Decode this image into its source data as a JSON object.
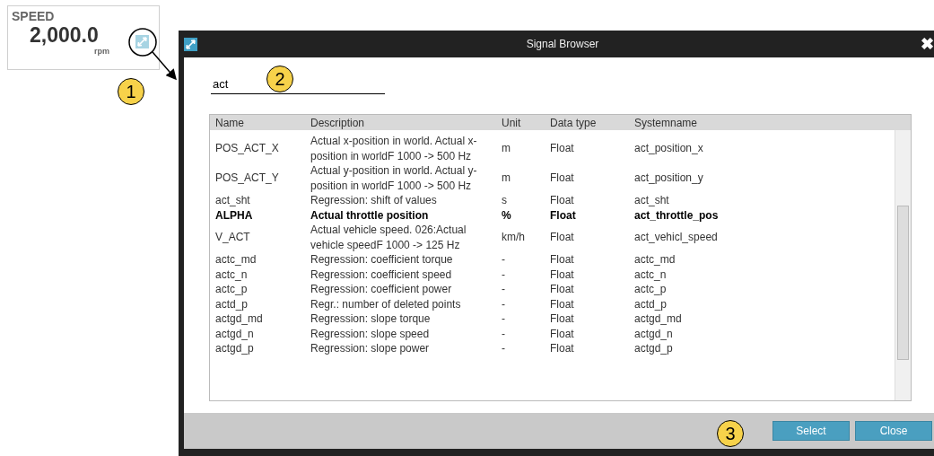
{
  "widget": {
    "label": "SPEED",
    "value": "2,000.0",
    "unit": "rpm"
  },
  "callouts": [
    "1",
    "2",
    "3"
  ],
  "dialog": {
    "title": "Signal Browser",
    "close": "✖",
    "search": {
      "value": "act"
    },
    "table": {
      "columns": [
        "Name",
        "Description",
        "Unit",
        "Data type",
        "Systemname"
      ],
      "rows": [
        {
          "name": "POS_ACT_X",
          "description": "Actual x-position in world. Actual x-position in worldF 1000 -> 500 Hz",
          "unit": "m",
          "type": "Float",
          "systemname": "act_position_x",
          "selected": false
        },
        {
          "name": "POS_ACT_Y",
          "description": "Actual y-position in world. Actual y-position in worldF 1000 -> 500 Hz",
          "unit": "m",
          "type": "Float",
          "systemname": "act_position_y",
          "selected": false
        },
        {
          "name": "act_sht",
          "description": "Regression: shift of values",
          "unit": "s",
          "type": "Float",
          "systemname": "act_sht",
          "selected": false
        },
        {
          "name": "ALPHA",
          "description": "Actual throttle position",
          "unit": "%",
          "type": "Float",
          "systemname": "act_throttle_pos",
          "selected": true
        },
        {
          "name": "V_ACT",
          "description": "Actual vehicle speed. 026:Actual vehicle speedF 1000 -> 125 Hz",
          "unit": "km/h",
          "type": "Float",
          "systemname": "act_vehicl_speed",
          "selected": false
        },
        {
          "name": "actc_md",
          "description": "Regression: coefficient torque",
          "unit": "-",
          "type": "Float",
          "systemname": "actc_md",
          "selected": false
        },
        {
          "name": "actc_n",
          "description": "Regression: coefficient speed",
          "unit": "-",
          "type": "Float",
          "systemname": "actc_n",
          "selected": false
        },
        {
          "name": "actc_p",
          "description": "Regression: coefficient power",
          "unit": "-",
          "type": "Float",
          "systemname": "actc_p",
          "selected": false
        },
        {
          "name": "actd_p",
          "description": "Regr.: number of deleted points",
          "unit": "-",
          "type": "Float",
          "systemname": "actd_p",
          "selected": false
        },
        {
          "name": "actgd_md",
          "description": "Regression: slope torque",
          "unit": "-",
          "type": "Float",
          "systemname": "actgd_md",
          "selected": false
        },
        {
          "name": "actgd_n",
          "description": "Regression: slope speed",
          "unit": "-",
          "type": "Float",
          "systemname": "actgd_n",
          "selected": false
        },
        {
          "name": "actgd_p",
          "description": "Regression: slope power",
          "unit": "-",
          "type": "Float",
          "systemname": "actgd_p",
          "selected": false
        }
      ]
    },
    "buttons": [
      "Select",
      "Close"
    ]
  }
}
